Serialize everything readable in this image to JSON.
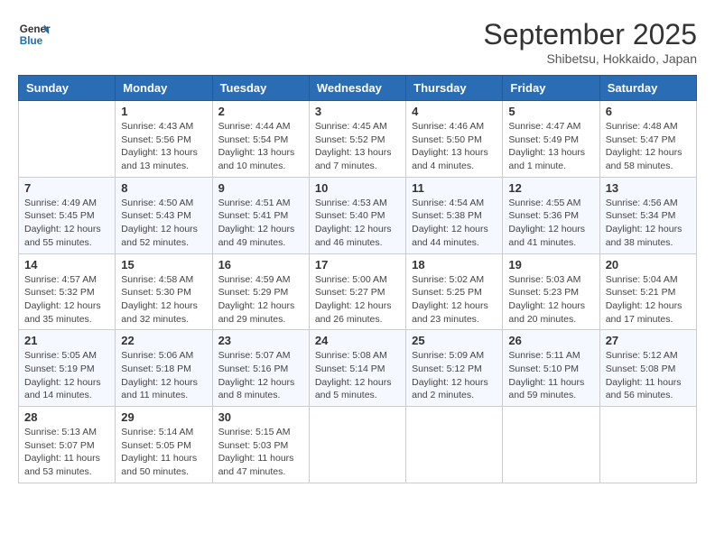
{
  "header": {
    "logo_line1": "General",
    "logo_line2": "Blue",
    "month": "September 2025",
    "location": "Shibetsu, Hokkaido, Japan"
  },
  "weekdays": [
    "Sunday",
    "Monday",
    "Tuesday",
    "Wednesday",
    "Thursday",
    "Friday",
    "Saturday"
  ],
  "weeks": [
    [
      {
        "day": "",
        "info": ""
      },
      {
        "day": "1",
        "info": "Sunrise: 4:43 AM\nSunset: 5:56 PM\nDaylight: 13 hours\nand 13 minutes."
      },
      {
        "day": "2",
        "info": "Sunrise: 4:44 AM\nSunset: 5:54 PM\nDaylight: 13 hours\nand 10 minutes."
      },
      {
        "day": "3",
        "info": "Sunrise: 4:45 AM\nSunset: 5:52 PM\nDaylight: 13 hours\nand 7 minutes."
      },
      {
        "day": "4",
        "info": "Sunrise: 4:46 AM\nSunset: 5:50 PM\nDaylight: 13 hours\nand 4 minutes."
      },
      {
        "day": "5",
        "info": "Sunrise: 4:47 AM\nSunset: 5:49 PM\nDaylight: 13 hours\nand 1 minute."
      },
      {
        "day": "6",
        "info": "Sunrise: 4:48 AM\nSunset: 5:47 PM\nDaylight: 12 hours\nand 58 minutes."
      }
    ],
    [
      {
        "day": "7",
        "info": "Sunrise: 4:49 AM\nSunset: 5:45 PM\nDaylight: 12 hours\nand 55 minutes."
      },
      {
        "day": "8",
        "info": "Sunrise: 4:50 AM\nSunset: 5:43 PM\nDaylight: 12 hours\nand 52 minutes."
      },
      {
        "day": "9",
        "info": "Sunrise: 4:51 AM\nSunset: 5:41 PM\nDaylight: 12 hours\nand 49 minutes."
      },
      {
        "day": "10",
        "info": "Sunrise: 4:53 AM\nSunset: 5:40 PM\nDaylight: 12 hours\nand 46 minutes."
      },
      {
        "day": "11",
        "info": "Sunrise: 4:54 AM\nSunset: 5:38 PM\nDaylight: 12 hours\nand 44 minutes."
      },
      {
        "day": "12",
        "info": "Sunrise: 4:55 AM\nSunset: 5:36 PM\nDaylight: 12 hours\nand 41 minutes."
      },
      {
        "day": "13",
        "info": "Sunrise: 4:56 AM\nSunset: 5:34 PM\nDaylight: 12 hours\nand 38 minutes."
      }
    ],
    [
      {
        "day": "14",
        "info": "Sunrise: 4:57 AM\nSunset: 5:32 PM\nDaylight: 12 hours\nand 35 minutes."
      },
      {
        "day": "15",
        "info": "Sunrise: 4:58 AM\nSunset: 5:30 PM\nDaylight: 12 hours\nand 32 minutes."
      },
      {
        "day": "16",
        "info": "Sunrise: 4:59 AM\nSunset: 5:29 PM\nDaylight: 12 hours\nand 29 minutes."
      },
      {
        "day": "17",
        "info": "Sunrise: 5:00 AM\nSunset: 5:27 PM\nDaylight: 12 hours\nand 26 minutes."
      },
      {
        "day": "18",
        "info": "Sunrise: 5:02 AM\nSunset: 5:25 PM\nDaylight: 12 hours\nand 23 minutes."
      },
      {
        "day": "19",
        "info": "Sunrise: 5:03 AM\nSunset: 5:23 PM\nDaylight: 12 hours\nand 20 minutes."
      },
      {
        "day": "20",
        "info": "Sunrise: 5:04 AM\nSunset: 5:21 PM\nDaylight: 12 hours\nand 17 minutes."
      }
    ],
    [
      {
        "day": "21",
        "info": "Sunrise: 5:05 AM\nSunset: 5:19 PM\nDaylight: 12 hours\nand 14 minutes."
      },
      {
        "day": "22",
        "info": "Sunrise: 5:06 AM\nSunset: 5:18 PM\nDaylight: 12 hours\nand 11 minutes."
      },
      {
        "day": "23",
        "info": "Sunrise: 5:07 AM\nSunset: 5:16 PM\nDaylight: 12 hours\nand 8 minutes."
      },
      {
        "day": "24",
        "info": "Sunrise: 5:08 AM\nSunset: 5:14 PM\nDaylight: 12 hours\nand 5 minutes."
      },
      {
        "day": "25",
        "info": "Sunrise: 5:09 AM\nSunset: 5:12 PM\nDaylight: 12 hours\nand 2 minutes."
      },
      {
        "day": "26",
        "info": "Sunrise: 5:11 AM\nSunset: 5:10 PM\nDaylight: 11 hours\nand 59 minutes."
      },
      {
        "day": "27",
        "info": "Sunrise: 5:12 AM\nSunset: 5:08 PM\nDaylight: 11 hours\nand 56 minutes."
      }
    ],
    [
      {
        "day": "28",
        "info": "Sunrise: 5:13 AM\nSunset: 5:07 PM\nDaylight: 11 hours\nand 53 minutes."
      },
      {
        "day": "29",
        "info": "Sunrise: 5:14 AM\nSunset: 5:05 PM\nDaylight: 11 hours\nand 50 minutes."
      },
      {
        "day": "30",
        "info": "Sunrise: 5:15 AM\nSunset: 5:03 PM\nDaylight: 11 hours\nand 47 minutes."
      },
      {
        "day": "",
        "info": ""
      },
      {
        "day": "",
        "info": ""
      },
      {
        "day": "",
        "info": ""
      },
      {
        "day": "",
        "info": ""
      }
    ]
  ]
}
